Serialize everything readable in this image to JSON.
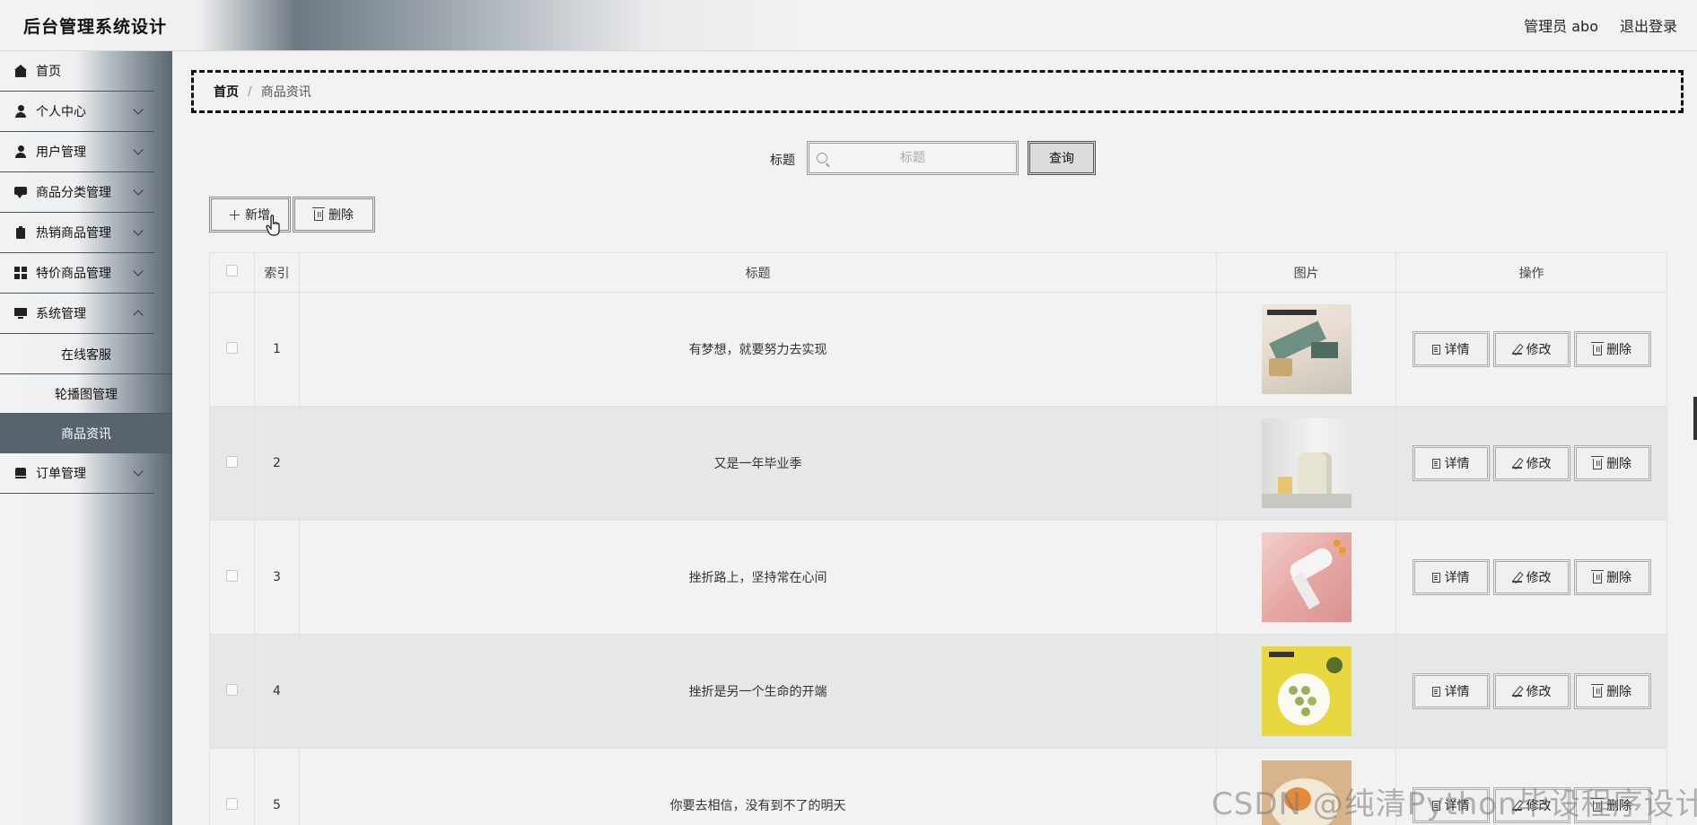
{
  "header": {
    "title": "后台管理系统设计",
    "user": "管理员 abo",
    "logout": "退出登录"
  },
  "sidebar": {
    "items": [
      {
        "label": "首页",
        "icon": "home-icon"
      },
      {
        "label": "个人中心",
        "icon": "user-icon"
      },
      {
        "label": "用户管理",
        "icon": "user-icon"
      },
      {
        "label": "商品分类管理",
        "icon": "chat-icon"
      },
      {
        "label": "热销商品管理",
        "icon": "clipboard-icon"
      },
      {
        "label": "特价商品管理",
        "icon": "grid-icon"
      },
      {
        "label": "系统管理",
        "icon": "monitor-icon"
      },
      {
        "label": "订单管理",
        "icon": "order-icon"
      }
    ],
    "sub_items": [
      {
        "label": "在线客服"
      },
      {
        "label": "轮播图管理"
      },
      {
        "label": "商品资讯"
      }
    ],
    "active_sub": "商品资讯"
  },
  "breadcrumb": {
    "home": "首页",
    "separator": "/",
    "current": "商品资讯"
  },
  "search": {
    "label": "标题",
    "placeholder": "标题",
    "button": "查询"
  },
  "toolbar": {
    "add_label": "新增",
    "delete_label": "删除"
  },
  "table": {
    "columns": [
      "索引",
      "标题",
      "图片",
      "操作"
    ],
    "rows": [
      {
        "index": "1",
        "title": "有梦想，就要努力去实现"
      },
      {
        "index": "2",
        "title": "又是一年毕业季"
      },
      {
        "index": "3",
        "title": "挫折路上，坚持常在心间"
      },
      {
        "index": "4",
        "title": "挫折是另一个生命的开端"
      },
      {
        "index": "5",
        "title": "你要去相信，没有到不了的明天"
      }
    ],
    "actions": {
      "detail": "详情",
      "edit": "修改",
      "delete": "删除"
    }
  },
  "watermark": "CSDN @纯清Python毕设程序设计",
  "colors": {
    "active_menu_bg": "#59636d",
    "alt_row_bg": "#e6e7e9"
  }
}
